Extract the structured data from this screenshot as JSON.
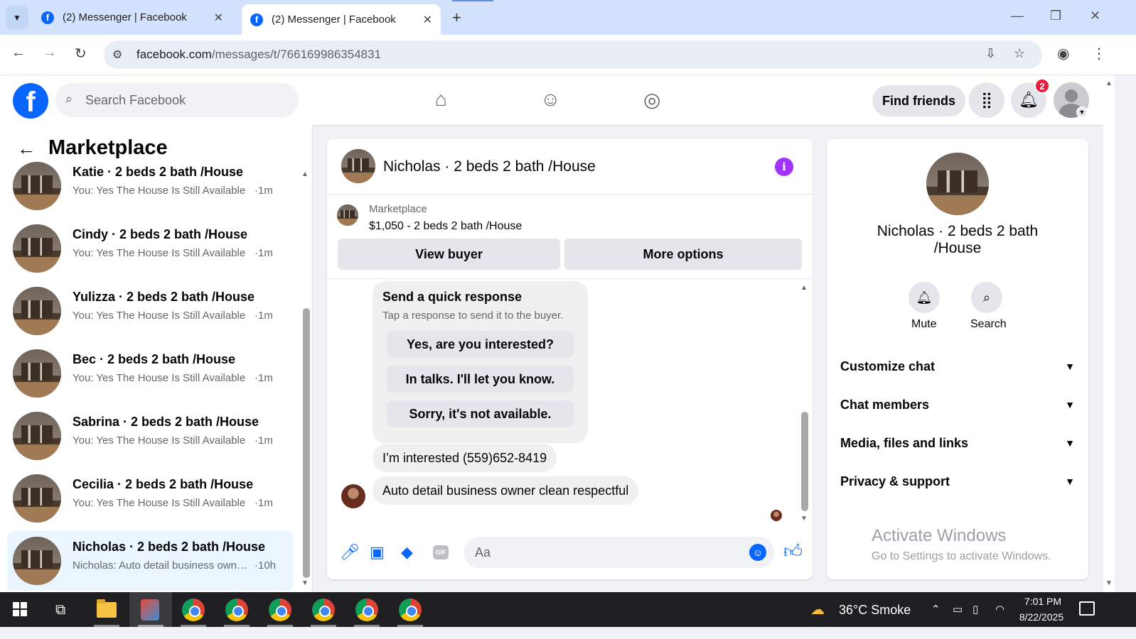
{
  "browser": {
    "tabs": [
      {
        "title": "(2) Messenger | Facebook",
        "active": false
      },
      {
        "title": "(2) Messenger | Facebook",
        "active": true
      }
    ],
    "new_tab_icon": "+",
    "close_icon": "✕",
    "address": {
      "host": "facebook.com",
      "path": "/messages/t/766169986354831"
    }
  },
  "fb_header": {
    "logo_letter": "f",
    "search_placeholder": "Search Facebook",
    "find_friends_label": "Find friends",
    "notification_count": "2",
    "nav_icons": [
      "home-icon",
      "friends-icon",
      "groups-icon"
    ]
  },
  "sidebar": {
    "title": "Marketplace",
    "conversations": [
      {
        "name": "Katie · 2 beds 2 bath /House",
        "preview": "You: Yes The House Is Still Available",
        "time": "·1m",
        "selected": false
      },
      {
        "name": "Cindy · 2 beds 2 bath /House",
        "preview": "You: Yes The House Is Still Available",
        "time": "·1m",
        "selected": false
      },
      {
        "name": "Yulizza · 2 beds 2 bath /House",
        "preview": "You: Yes The House Is Still Available",
        "time": "·1m",
        "selected": false
      },
      {
        "name": "Bec · 2 beds 2 bath /House",
        "preview": "You: Yes The House Is Still Available",
        "time": "·1m",
        "selected": false
      },
      {
        "name": "Sabrina · 2 beds 2 bath /House",
        "preview": "You: Yes The House Is Still Available",
        "time": "·1m",
        "selected": false
      },
      {
        "name": "Cecilia · 2 beds 2 bath /House",
        "preview": "You: Yes The House Is Still Available",
        "time": "·1m",
        "selected": false
      },
      {
        "name": "Nicholas · 2 beds 2 bath /House",
        "preview": "Nicholas: Auto detail business owner clean respectful",
        "time": "·10h",
        "selected": true
      }
    ]
  },
  "chat": {
    "title": "Nicholas · 2 beds 2 bath /House",
    "marketplace_label": "Marketplace",
    "listing": "$1,050 - 2 beds 2 bath /House",
    "view_buyer_label": "View buyer",
    "more_options_label": "More options",
    "quick_response": {
      "title": "Send a quick response",
      "subtitle": "Tap a response to send it to the buyer.",
      "options": [
        "Yes, are you interested?",
        "In talks. I'll let you know.",
        "Sorry, it's not available."
      ]
    },
    "messages": [
      {
        "text": "I’m interested (559)652-8419"
      },
      {
        "text": "Auto detail business owner clean respectful"
      }
    ],
    "composer_placeholder": "Aa"
  },
  "info_panel": {
    "name": "Nicholas · 2 beds 2 bath /House",
    "actions": [
      {
        "label": "Mute",
        "icon": "bell-icon"
      },
      {
        "label": "Search",
        "icon": "search-icon"
      }
    ],
    "sections": [
      "Customize chat",
      "Chat members",
      "Media, files and links",
      "Privacy & support"
    ],
    "watermark_title": "Activate Windows",
    "watermark_sub": "Go to Settings to activate Windows."
  },
  "taskbar": {
    "weather": "36°C  Smoke",
    "time": "7:01 PM",
    "date": "8/22/2025"
  },
  "colors": {
    "facebook_blue": "#0866ff",
    "info_purple": "#a033ff",
    "badge_red": "#e41e3f",
    "selected_row": "#ebf5ff"
  }
}
